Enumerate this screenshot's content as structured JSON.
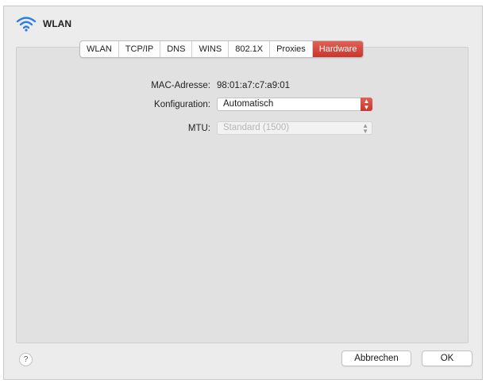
{
  "window": {
    "title": "WLAN",
    "title_icon": "wifi-icon",
    "accent_color": "#d0443a"
  },
  "tabs": [
    {
      "label": "WLAN",
      "active": false
    },
    {
      "label": "TCP/IP",
      "active": false
    },
    {
      "label": "DNS",
      "active": false
    },
    {
      "label": "WINS",
      "active": false
    },
    {
      "label": "802.1X",
      "active": false
    },
    {
      "label": "Proxies",
      "active": false
    },
    {
      "label": "Hardware",
      "active": true
    }
  ],
  "hardware": {
    "mac_label": "MAC-Adresse:",
    "mac_value": "98:01:a7:c7:a9:01",
    "config_label": "Konfiguration:",
    "config_value": "Automatisch",
    "mtu_label": "MTU:",
    "mtu_value": "Standard (1500)"
  },
  "footer": {
    "help_label": "?",
    "cancel_label": "Abbrechen",
    "ok_label": "OK"
  }
}
